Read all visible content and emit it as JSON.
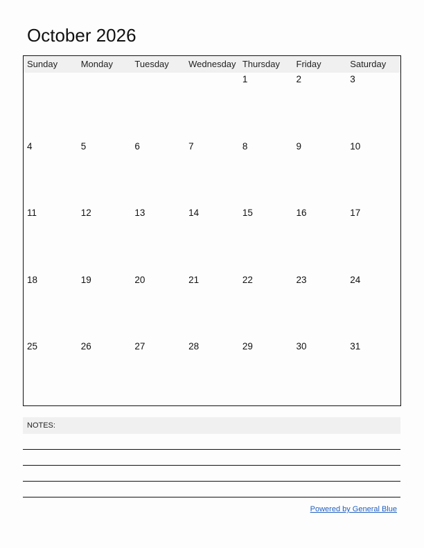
{
  "calendar": {
    "title": "October 2026",
    "weekdays": [
      "Sunday",
      "Monday",
      "Tuesday",
      "Wednesday",
      "Thursday",
      "Friday",
      "Saturday"
    ],
    "weeks": [
      [
        "",
        "",
        "",
        "",
        "1",
        "2",
        "3"
      ],
      [
        "4",
        "5",
        "6",
        "7",
        "8",
        "9",
        "10"
      ],
      [
        "11",
        "12",
        "13",
        "14",
        "15",
        "16",
        "17"
      ],
      [
        "18",
        "19",
        "20",
        "21",
        "22",
        "23",
        "24"
      ],
      [
        "25",
        "26",
        "27",
        "28",
        "29",
        "30",
        "31"
      ]
    ]
  },
  "notes": {
    "label": "NOTES:",
    "line_count": 4
  },
  "footer": {
    "link_text": "Powered by General Blue",
    "link_color": "#1f5fbf"
  },
  "colors": {
    "header_bg": "#f0f0f0",
    "border": "#111111"
  }
}
